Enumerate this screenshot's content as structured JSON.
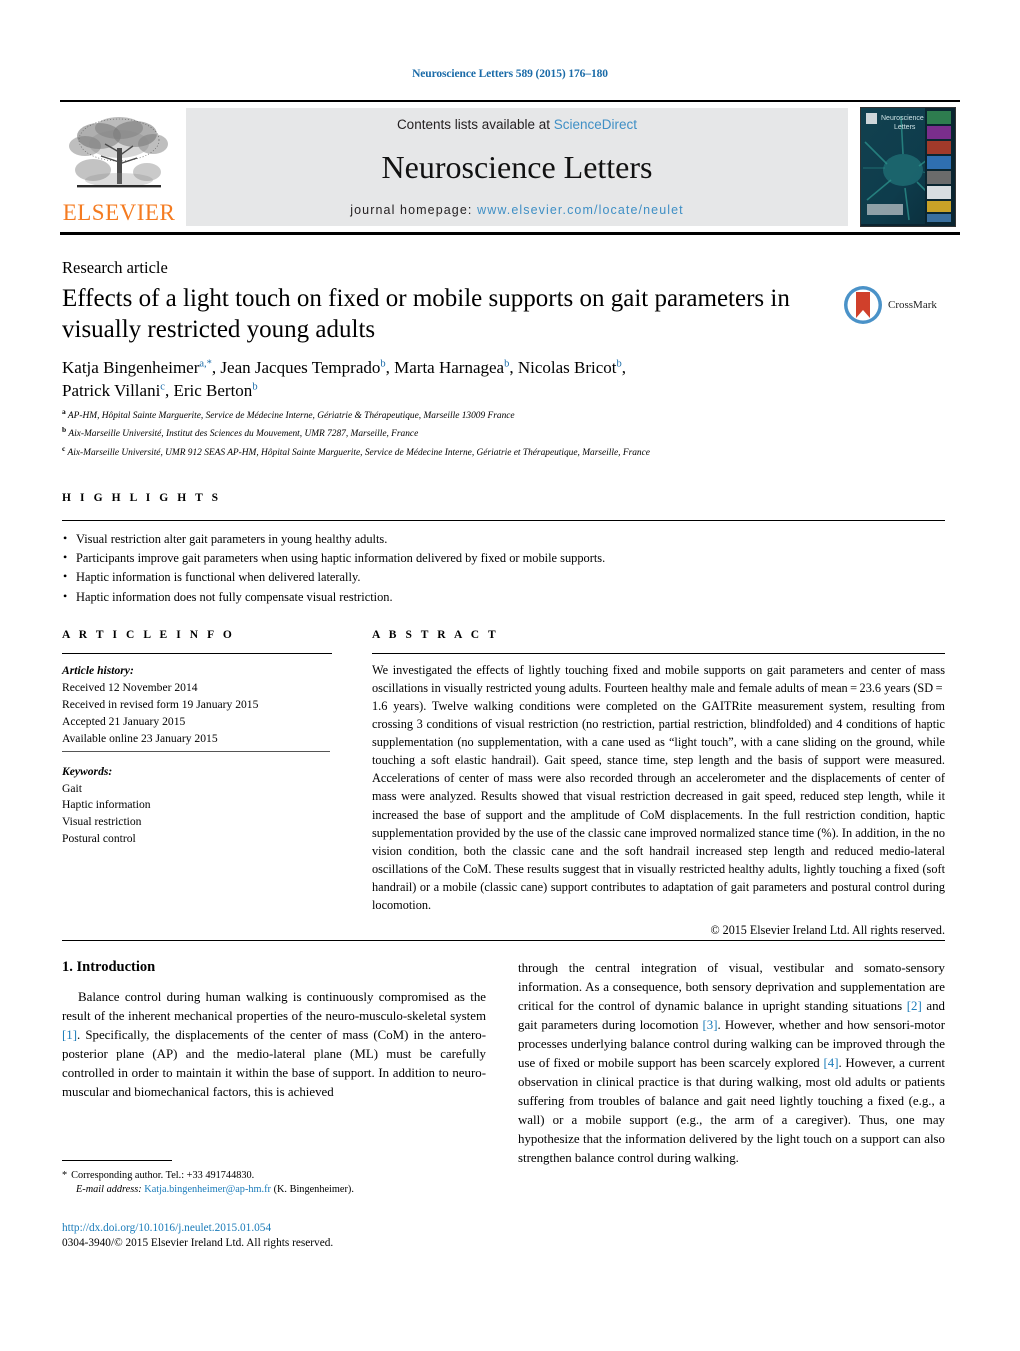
{
  "running_head": "Neuroscience Letters 589 (2015) 176–180",
  "masthead": {
    "publisher_name": "ELSEVIER",
    "publisher_logo_icon": "elsevier-tree-logo",
    "contents_prefix": "Contents lists available at ",
    "contents_link": "ScienceDirect",
    "journal_title": "Neuroscience Letters",
    "homepage_prefix": "journal homepage: ",
    "homepage_url": "www.elsevier.com/locate/neulet",
    "cover_title": "Neuroscience Letters",
    "cover_icon": "journal-cover-thumbnail"
  },
  "article": {
    "doctype": "Research article",
    "title": "Effects of a light touch on fixed or mobile supports on gait parameters in visually restricted young adults",
    "crossmark_label": "CrossMark",
    "crossmark_icon": "crossmark-logo",
    "authors_line1_parts": [
      {
        "name": "Katja Bingenheimer",
        "sup": "a,*",
        "sep": ", "
      },
      {
        "name": "Jean Jacques Temprado",
        "sup": "b",
        "sep": ", "
      },
      {
        "name": "Marta Harnagea",
        "sup": "b",
        "sep": ", "
      },
      {
        "name": "Nicolas Bricot",
        "sup": "b",
        "sep": ","
      }
    ],
    "authors_line2_parts": [
      {
        "name": "Patrick Villani",
        "sup": "c",
        "sep": ", "
      },
      {
        "name": "Eric Berton",
        "sup": "b",
        "sep": ""
      }
    ],
    "affiliations": [
      {
        "mark": "a",
        "text": "AP-HM, Hôpital Sainte Marguerite, Service de Médecine Interne, Gériatrie & Thérapeutique, Marseille 13009 France"
      },
      {
        "mark": "b",
        "text": "Aix-Marseille Université, Institut des Sciences du Mouvement, UMR 7287, Marseille, France"
      },
      {
        "mark": "c",
        "text": "Aix-Marseille Université, UMR 912 SEAS AP-HM, Hôpital Sainte Marguerite, Service de Médecine Interne, Gériatrie et Thérapeutique, Marseille, France"
      }
    ]
  },
  "highlights": {
    "label": "H I G H L I G H T S",
    "items": [
      "Visual restriction alter gait parameters in young healthy adults.",
      "Participants improve gait parameters when using haptic information delivered by fixed or mobile supports.",
      "Haptic information is functional when delivered laterally.",
      "Haptic information does not fully compensate visual restriction."
    ]
  },
  "article_info": {
    "label": "A R T I C L E   I N F O",
    "history_heading": "Article history:",
    "history": [
      "Received 12 November 2014",
      "Received in revised form 19 January 2015",
      "Accepted 21 January 2015",
      "Available online 23 January 2015"
    ],
    "keywords_heading": "Keywords:",
    "keywords": [
      "Gait",
      "Haptic information",
      "Visual restriction",
      "Postural control"
    ]
  },
  "abstract": {
    "label": "A B S T R A C T",
    "text": "We investigated the effects of lightly touching fixed and mobile supports on gait parameters and center of mass oscillations in visually restricted young adults. Fourteen healthy male and female adults of mean = 23.6 years (SD = 1.6 years). Twelve walking conditions were completed on the GAITRite measurement system, resulting from crossing 3 conditions of visual restriction (no restriction, partial restriction, blindfolded) and 4 conditions of haptic supplementation (no supplementation, with a cane used as “light touch”, with a cane sliding on the ground, while touching a soft elastic handrail). Gait speed, stance time, step length and the basis of support were measured. Accelerations of center of mass were also recorded through an accelerometer and the displacements of center of mass were analyzed. Results showed that visual restriction decreased in gait speed, reduced step length, while it increased the base of support and the amplitude of CoM displacements. In the full restriction condition, haptic supplementation provided by the use of the classic cane improved normalized stance time (%). In addition, in the no vision condition, both the classic cane and the soft handrail increased step length and reduced medio-lateral oscillations of the CoM. These results suggest that in visually restricted healthy adults, lightly touching a fixed (soft handrail) or a mobile (classic cane) support contributes to adaptation of gait parameters and postural control during locomotion.",
    "copyright": "© 2015 Elsevier Ireland Ltd. All rights reserved."
  },
  "body": {
    "intro_heading": "1.  Introduction",
    "left_paragraph_a": "Balance control during human walking is continuously compromised as the result of the inherent mechanical properties of the neuro-musculo-skeletal system ",
    "left_ref_1": "[1]",
    "left_paragraph_b": ". Specifically, the displacements of the center of mass (CoM) in the antero-posterior plane (AP) and the medio-lateral plane (ML) must be carefully controlled in order to maintain it within the base of support. In addition to neuro-muscular and biomechanical factors, this is achieved",
    "right_paragraph_a": "through the central integration of visual, vestibular and somato-sensory information. As a consequence, both sensory deprivation and supplementation are critical for the control of dynamic balance in upright standing situations ",
    "right_ref_2": "[2]",
    "right_paragraph_b": " and gait parameters during locomotion ",
    "right_ref_3": "[3]",
    "right_paragraph_c": ". However, whether and how sensori-motor processes underlying balance control during walking can be improved through the use of fixed or mobile support has been scarcely explored ",
    "right_ref_4": "[4]",
    "right_paragraph_d": ". However, a current observation in clinical practice is that during walking, most old adults or patients suffering from troubles of balance and gait need lightly touching a fixed (e.g., a wall) or a mobile support (e.g., the arm of a caregiver). Thus, one may hypothesize that the information delivered by the light touch on a support can also strengthen balance control during walking."
  },
  "footer": {
    "corresponding_star": "*",
    "corresponding_text": "Corresponding author. Tel.: +33 491744830.",
    "email_label": "E-mail address:",
    "email_address": "Katja.bingenheimer@ap-hm.fr",
    "email_suffix": "(K. Bingenheimer).",
    "doi": "http://dx.doi.org/10.1016/j.neulet.2015.01.054",
    "issn_line": "0304-3940/© 2015 Elsevier Ireland Ltd. All rights reserved."
  },
  "colors": {
    "link_blue": "#1a7bb9",
    "elsevier_orange": "#F47B20",
    "masthead_grey": "#e6e7e8"
  }
}
